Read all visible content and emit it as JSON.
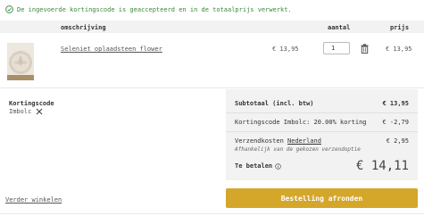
{
  "notice": {
    "text": "De ingevoerde kortingscode is geaccepteerd en in de totaalprijs verwerkt.",
    "color": "#3a8a3a"
  },
  "table": {
    "headers": {
      "description": "omschrijving",
      "quantity": "aantal",
      "price": "prijs"
    }
  },
  "item": {
    "name": "Seleniet oplaadsteen flower",
    "unit_price": "€ 13,95",
    "quantity": "1",
    "line_price": "€ 13,95"
  },
  "coupon": {
    "label": "Kortingscode",
    "code": "Imbolc"
  },
  "summary": {
    "subtotal_label": "Subtotaal (incl. btw)",
    "subtotal_value": "€ 13,95",
    "discount_label": "Kortingscode Imbolc: 20.00% korting",
    "discount_value": "€ -2,79",
    "shipping_label": "Verzendkosten",
    "shipping_link": "Nederland",
    "shipping_value": "€ 2,95",
    "shipping_note": "Afhankelijk van de gekozen verzendoptie",
    "total_label": "Te betalen",
    "total_value": "€ 14,11"
  },
  "actions": {
    "continue_label": "Verder winkelen",
    "order_label": "Bestelling afronden",
    "accent": "#d4a62a"
  }
}
